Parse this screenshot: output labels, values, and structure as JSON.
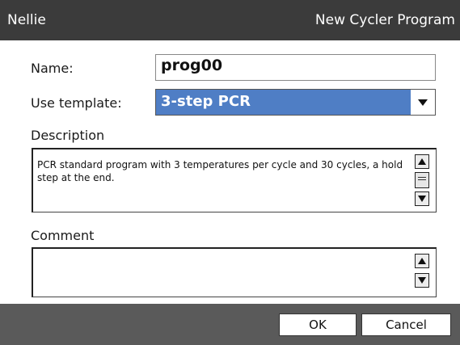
{
  "window": {
    "app_name": "Nellie",
    "title": "New Cycler Program"
  },
  "form": {
    "name_label": "Name:",
    "name_value": "prog00",
    "template_label": "Use template:",
    "template_value": "3-step PCR",
    "description_label": "Description",
    "description_text": "PCR standard program with 3 temperatures per cycle and 30 cycles, a hold step at the end.",
    "comment_label": "Comment",
    "comment_text": ""
  },
  "buttons": {
    "ok": "OK",
    "cancel": "Cancel"
  },
  "colors": {
    "titlebar": "#3b3b3b",
    "footer": "#5a5a5a",
    "select_highlight": "#4f7ec5"
  },
  "icons": {
    "dropdown": "chevron-down-icon",
    "scroll_up": "arrow-up-icon",
    "scroll_down": "arrow-down-icon"
  }
}
